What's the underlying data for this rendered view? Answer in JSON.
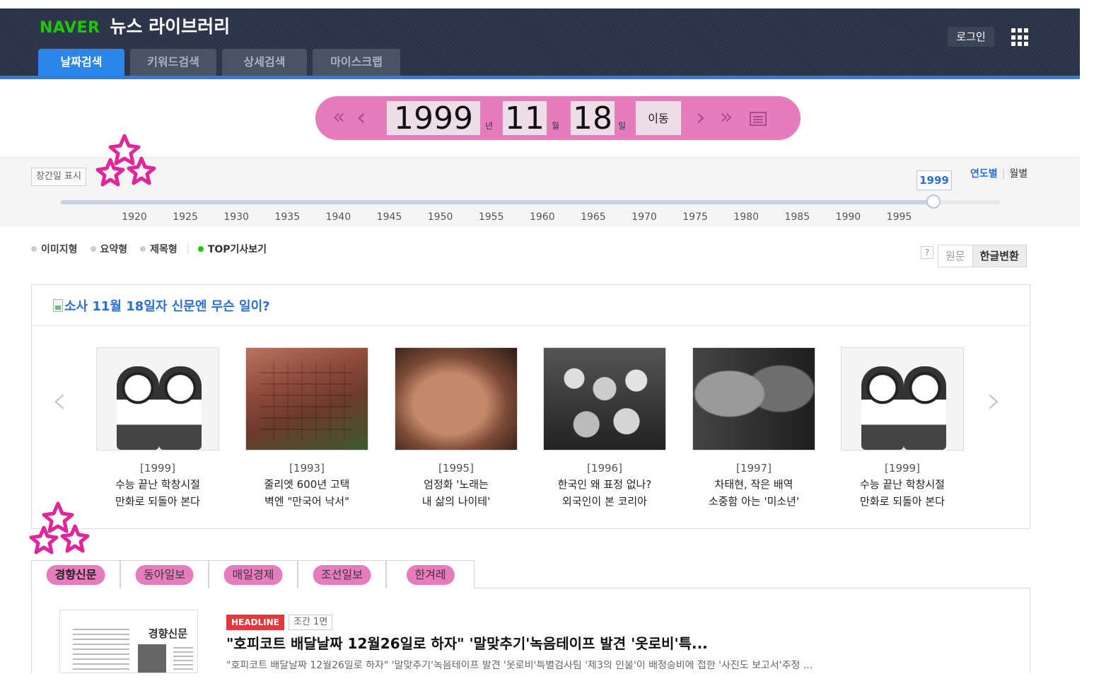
{
  "header": {
    "brand": "NAVER",
    "service_title": "뉴스 라이브러리",
    "login_label": "로그인",
    "apps_icon": "grid-icon",
    "tabs": [
      {
        "label": "날짜검색",
        "active": true
      },
      {
        "label": "키워드검색",
        "active": false
      },
      {
        "label": "상세검색",
        "active": false
      },
      {
        "label": "마이스크랩",
        "active": false
      }
    ]
  },
  "date_nav": {
    "year": "1999",
    "year_unit": "년",
    "month": "11",
    "month_unit": "월",
    "day": "18",
    "day_unit": "일",
    "go_label": "이동",
    "icons": [
      "double-left-icon",
      "left-icon",
      "right-icon",
      "double-right-icon",
      "calendar-icon"
    ],
    "accent_color": "#e67bbe"
  },
  "timeline": {
    "founded_label": "창간일 표시",
    "selected_year": "1999",
    "view_year_label": "연도별",
    "view_month_label": "월별",
    "ticks": [
      "1920",
      "1925",
      "1930",
      "1935",
      "1940",
      "1945",
      "1950",
      "1955",
      "1960",
      "1965",
      "1970",
      "1975",
      "1980",
      "1985",
      "1990",
      "1995"
    ],
    "range": [
      1920,
      1999
    ],
    "current": 1999
  },
  "view_options": {
    "items": [
      {
        "label": "이미지형",
        "selected": false
      },
      {
        "label": "요약형",
        "selected": false
      },
      {
        "label": "제목형",
        "selected": false
      },
      {
        "label": "TOP기사보기",
        "selected": true
      }
    ],
    "help_label": "?",
    "original_label": "원문",
    "hangul_label": "한글변환"
  },
  "top_stories": {
    "title": "소사 11월 18일자 신문엔 무슨 일이?",
    "cards": [
      {
        "year": "[1999]",
        "line1": "수능 끝난 학창시절",
        "line2": "만화로 되돌아 본다"
      },
      {
        "year": "[1993]",
        "line1": "줄리엣 600년 고택",
        "line2": "벽엔 \"만국어 낙서\""
      },
      {
        "year": "[1995]",
        "line1": "엄정화 '노래는",
        "line2": "내 삶의 나이테'"
      },
      {
        "year": "[1996]",
        "line1": "한국인 왜 표정 없나?",
        "line2": "외국인이 본 코리아"
      },
      {
        "year": "[1997]",
        "line1": "차태현, 작은 배역",
        "line2": "소중함 아는 '미소년'"
      },
      {
        "year": "[1999]",
        "line1": "수능 끝난 학창시절",
        "line2": "만화로 되돌아 본다"
      }
    ]
  },
  "newspapers": {
    "tabs": [
      {
        "label": "경향신문",
        "active": true
      },
      {
        "label": "동아일보",
        "active": false
      },
      {
        "label": "매일경제",
        "active": false
      },
      {
        "label": "조선일보",
        "active": false
      },
      {
        "label": "한겨레",
        "active": false
      }
    ]
  },
  "article": {
    "paper_name": "경향신문",
    "badge": "HEADLINE",
    "page": "조간 1면",
    "headline": "\"호피코트 배달날짜 12월26일로 하자\" '말맞추기'녹음테이프 발견 '옷로비'특...",
    "snippet": "\"호피코트 배달날짜 12월26일로 하자\" '말맞추기'녹음테이프 발견 '옷로비'특별검사팀 '제3의 인물'이 배정승비에 접한 '사진도 보고서'추정 ..."
  }
}
